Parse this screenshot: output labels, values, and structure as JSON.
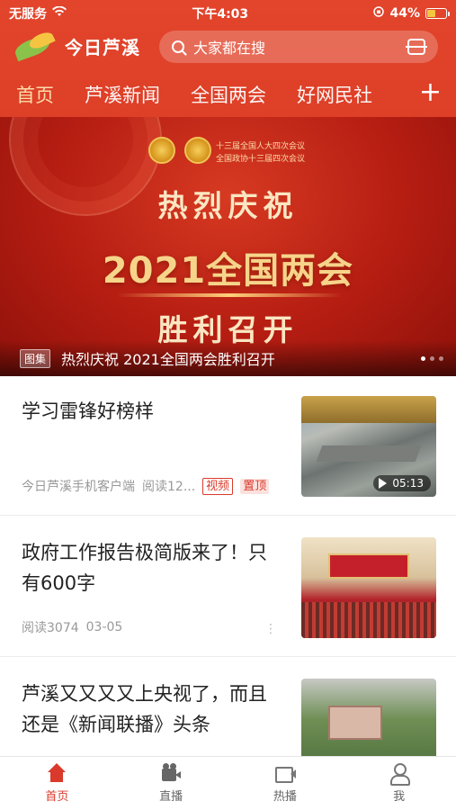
{
  "status": {
    "carrier": "无服务",
    "time": "下午4:03",
    "battery": "44%"
  },
  "header": {
    "logo_text": "今日芦溪",
    "search_placeholder": "大家都在搜",
    "tabs": [
      "首页",
      "芦溪新闻",
      "全国两会",
      "好网民社"
    ],
    "add_label": "+"
  },
  "banner": {
    "subtitle_1": "十三届全国人大四次会议",
    "subtitle_2": "全国政协十三届四次会议",
    "line1": "热烈庆祝",
    "line2": "2021全国两会",
    "line3": "胜利召开",
    "badge": "图集",
    "caption": "热烈庆祝 2021全国两会胜利召开"
  },
  "news": [
    {
      "title": "学习雷锋好榜样",
      "source": "今日芦溪手机客户端",
      "reads": "阅读12...",
      "tag_video": "视频",
      "tag_top": "置顶",
      "duration": "05:13"
    },
    {
      "title": "政府工作报告极简版来了！只有600字",
      "reads": "阅读3074",
      "date": "03-05",
      "more": "⋮"
    },
    {
      "title": "芦溪又又又又上央视了，而且还是《新闻联播》头条"
    }
  ],
  "tabbar": {
    "items": [
      "首页",
      "直播",
      "热播",
      "我"
    ]
  },
  "colors": {
    "brand": "#e2452c",
    "accent": "#d93a2b",
    "tab_active": "#ffe4b0"
  }
}
